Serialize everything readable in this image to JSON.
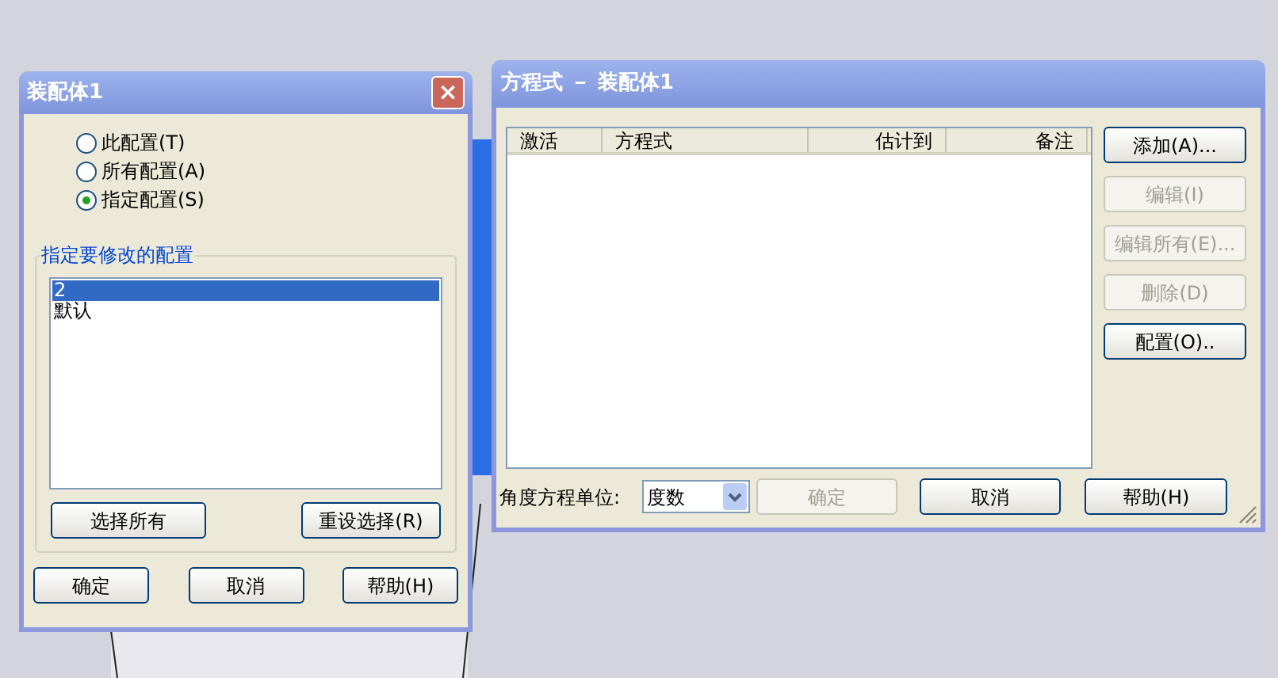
{
  "config_dialog": {
    "title": "装配体1",
    "close": "×",
    "options": [
      {
        "label": "此配置(T)",
        "selected": false
      },
      {
        "label": "所有配置(A)",
        "selected": false
      },
      {
        "label": "指定配置(S)",
        "selected": true
      }
    ],
    "group": {
      "label": "指定要修改的配置",
      "items": [
        {
          "label": "2",
          "selected": true
        },
        {
          "label": "默认",
          "selected": false
        }
      ],
      "buttons": [
        "选择所有",
        "重设选择(R)"
      ]
    },
    "buttons": [
      "确定",
      "取消",
      "帮助(H)"
    ]
  },
  "equation_dialog": {
    "title": "方程式 － 装配体1",
    "table": {
      "columns": [
        {
          "label": "激活",
          "right_aligned": false
        },
        {
          "label": "方程式",
          "right_aligned": false
        },
        {
          "label": "估计到",
          "right_aligned": true
        },
        {
          "label": "备注",
          "right_aligned": true
        }
      ]
    },
    "side_buttons": [
      {
        "label": "添加(A)...",
        "disabled": false
      },
      {
        "label": "编辑(I)",
        "disabled": true
      },
      {
        "label": "编辑所有(E)...",
        "disabled": true
      },
      {
        "label": "删除(D)",
        "disabled": true
      },
      {
        "label": "配置(O)..",
        "disabled": false
      }
    ],
    "unit_label": "角度方程单位:",
    "unit_value": "度数",
    "buttons": [
      {
        "label": "确定",
        "disabled": true
      },
      {
        "label": "取消",
        "disabled": false
      },
      {
        "label": "帮助(H)",
        "disabled": false
      }
    ]
  }
}
